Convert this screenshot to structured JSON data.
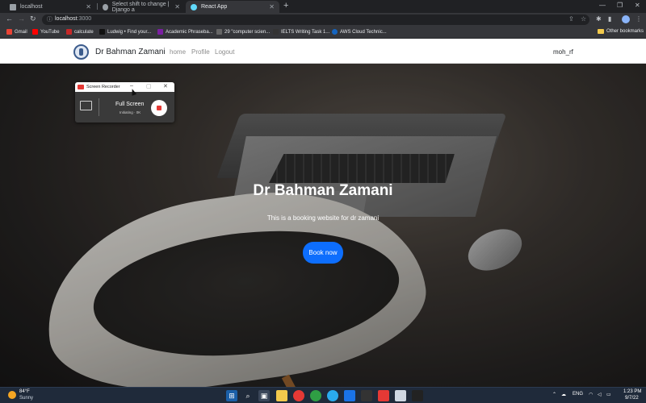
{
  "browser": {
    "tabs": [
      {
        "title": "localhost",
        "active": false
      },
      {
        "title": "Select shift to change | Django a",
        "active": false
      },
      {
        "title": "React App",
        "active": true
      }
    ],
    "new_tab_label": "+",
    "address": {
      "host": "localhost",
      "port": ":3000"
    },
    "bookmarks": [
      {
        "label": "Gmail",
        "color": "#ea4335"
      },
      {
        "label": "YouTube",
        "color": "#ff0000"
      },
      {
        "label": "calculate",
        "color": "#c62828"
      },
      {
        "label": "Ludwig • Find your...",
        "color": "#111111"
      },
      {
        "label": "Academic Phraseba...",
        "color": "#7b1fa2"
      },
      {
        "label": "29 \"computer scien...",
        "color": "#666666"
      },
      {
        "label": "IELTS Writing Task 1...",
        "color": "#333333"
      },
      {
        "label": "AWS Cloud Technic...",
        "color": "#1565c0"
      }
    ],
    "other_bookmarks": "Other bookmarks"
  },
  "site": {
    "brand": "Dr Bahman Zamani",
    "nav": [
      {
        "label": "home"
      },
      {
        "label": "Profile"
      },
      {
        "label": "Logout"
      }
    ],
    "user": "moh_rf",
    "hero": {
      "title": "Dr Bahman Zamani",
      "subtitle": "This is a booking website for dr zamani",
      "button": "Book now"
    }
  },
  "recorder": {
    "title": "Screen Recorder",
    "mode": "Full Screen",
    "status": "Initiating · 0K"
  },
  "taskbar": {
    "weather": {
      "temp": "84°F",
      "desc": "Sunny"
    },
    "language": "ENG",
    "time": "1:23 PM",
    "date": "9/7/22"
  },
  "colors": {
    "accent": "#0d6efd",
    "record": "#e53935"
  }
}
